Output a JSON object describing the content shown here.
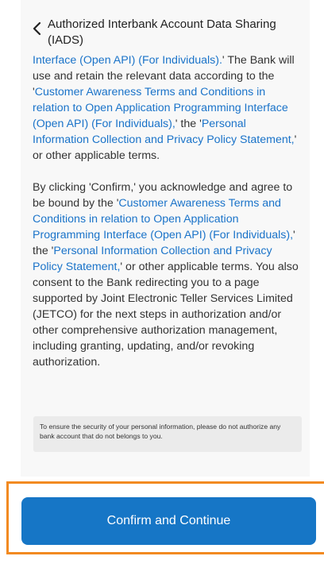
{
  "header": {
    "title": "Authorized Interbank Account Data Sharing (IADS)"
  },
  "icons": {
    "back": "chevron-left-icon"
  },
  "content": {
    "p1": {
      "link_a": "Interface (Open API) (For Individuals).",
      "text_a": "' The Bank will use and retain the relevant data according to the '",
      "link_b": "Customer Awareness Terms and Conditions in relation to Open Application Programming Interface (Open API) (For Individuals),",
      "text_b": "' the '",
      "link_c": "Personal Information Collection and Privacy Policy Statement,",
      "text_c": "' or other applicable terms."
    },
    "p2": {
      "text_a": "By clicking 'Confirm,' you acknowledge and agree to be bound by the '",
      "link_a": "Customer Awareness Terms and Conditions in relation to Open Application Programming Interface (Open API) (For Individuals),",
      "text_b": "' the '",
      "link_b": "Personal Information Collection and Privacy Policy Statement,",
      "text_c": "' or other applicable terms. You also consent to the Bank redirecting you to a page supported by Joint Electronic Teller Services Limited (JETCO) for the next steps in authorization and/or other comprehensive authorization management, including granting, updating, and/or revoking authorization."
    },
    "notice": "To ensure the security of your personal information, please do not authorize any bank account that do not belongs to you."
  },
  "footer": {
    "confirm_label": "Confirm and Continue"
  },
  "colors": {
    "link": "#1a73c9",
    "button": "#1676c6",
    "highlight": "#f28a21"
  }
}
